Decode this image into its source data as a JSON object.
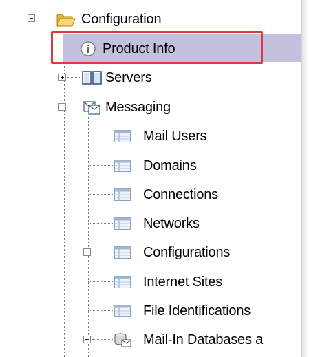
{
  "tree": {
    "root": {
      "label": "Configuration",
      "icon": "folder-open-icon"
    },
    "items": {
      "product_info": "Product Info",
      "servers": "Servers",
      "messaging": "Messaging",
      "mail_users": "Mail Users",
      "domains": "Domains",
      "connections": "Connections",
      "networks": "Networks",
      "configurations": "Configurations",
      "internet_sites": "Internet Sites",
      "file_identifications": "File Identifications",
      "mail_in_databases": "Mail-In Databases a"
    },
    "selected": "Product Info"
  },
  "colors": {
    "selection_bg": "#c3c2de",
    "highlight_border": "#e2383c",
    "folder": "#f3c24f"
  }
}
